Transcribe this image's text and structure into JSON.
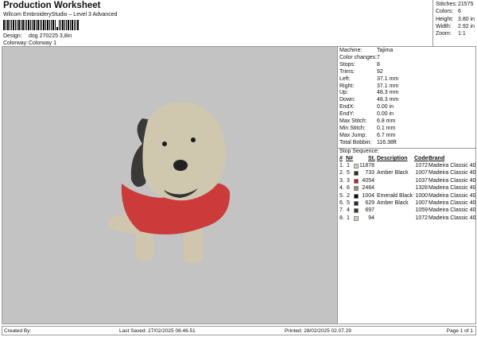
{
  "header": {
    "title": "Production Worksheet",
    "subtitle": "Wilcom EmbroideryStudio – Level 3 Advanced",
    "design_label": "Design:",
    "design_value": "dog 270225 3,8in",
    "colorway_label": "Colorway:",
    "colorway_value": "Colorway 1"
  },
  "summary": [
    {
      "label": "Stitches:",
      "value": "21575"
    },
    {
      "label": "Colors:",
      "value": "6"
    },
    {
      "label": "Height:",
      "value": "3.80 in"
    },
    {
      "label": "Width:",
      "value": "2.92 in"
    },
    {
      "label": "Zoom:",
      "value": "1:1"
    }
  ],
  "info": [
    {
      "label": "Machine:",
      "value": "Tajima"
    },
    {
      "label": "Color changes:",
      "value": "7"
    },
    {
      "label": "Stops:",
      "value": "8"
    },
    {
      "label": "Trims:",
      "value": "92"
    },
    {
      "label": "Left:",
      "value": "37.1 mm"
    },
    {
      "label": "Right:",
      "value": "37.1 mm"
    },
    {
      "label": "Up:",
      "value": "48.3 mm"
    },
    {
      "label": "Down:",
      "value": "48.3 mm"
    },
    {
      "label": "EndX:",
      "value": "0.00 in"
    },
    {
      "label": "EndY:",
      "value": "0.00 in"
    },
    {
      "label": "Max Stitch:",
      "value": "6.8 mm"
    },
    {
      "label": "Min Stitch:",
      "value": "0.1 mm"
    },
    {
      "label": "Max Jump:",
      "value": "6.7 mm"
    },
    {
      "label": "Total Bobbin:",
      "value": "116.38ft"
    }
  ],
  "stop_sequence": {
    "title": "Stop Sequence:",
    "columns": [
      "#",
      "N#",
      "St.",
      "Description",
      "Code",
      "Brand"
    ],
    "rows": [
      {
        "idx": "1.",
        "n": "1",
        "color": "#d8d0b8",
        "st": "11878",
        "desc": "",
        "code": "1072",
        "brand": "Madeira Classic 40"
      },
      {
        "idx": "2.",
        "n": "5",
        "color": "#2a2a2a",
        "st": "733",
        "desc": "Amber Black",
        "code": "1007",
        "brand": "Madeira Classic 40"
      },
      {
        "idx": "3.",
        "n": "3",
        "color": "#c8202a",
        "st": "4054",
        "desc": "",
        "code": "1037",
        "brand": "Madeira Classic 40"
      },
      {
        "idx": "4.",
        "n": "6",
        "color": "#9a8a80",
        "st": "2484",
        "desc": "",
        "code": "1328",
        "brand": "Madeira Classic 40"
      },
      {
        "idx": "5.",
        "n": "2",
        "color": "#050505",
        "st": "1004",
        "desc": "Emerald Black",
        "code": "1000",
        "brand": "Madeira Classic 40"
      },
      {
        "idx": "6.",
        "n": "5",
        "color": "#2a2a2a",
        "st": "629",
        "desc": "Amber Black",
        "code": "1007",
        "brand": "Madeira Classic 40"
      },
      {
        "idx": "7.",
        "n": "4",
        "color": "#3e3434",
        "st": "697",
        "desc": "",
        "code": "1059",
        "brand": "Madeira Classic 40"
      },
      {
        "idx": "8.",
        "n": "1",
        "color": "#d8d0b8",
        "st": "94",
        "desc": "",
        "code": "1072",
        "brand": "Madeira Classic 40"
      }
    ]
  },
  "footer": {
    "created_by": "Created By:",
    "last_saved": "Last Saved: 27/02/2025 08.46.51",
    "printed": "Printed: 28/02/2025 02.07.29",
    "page": "Page 1 of 1"
  }
}
